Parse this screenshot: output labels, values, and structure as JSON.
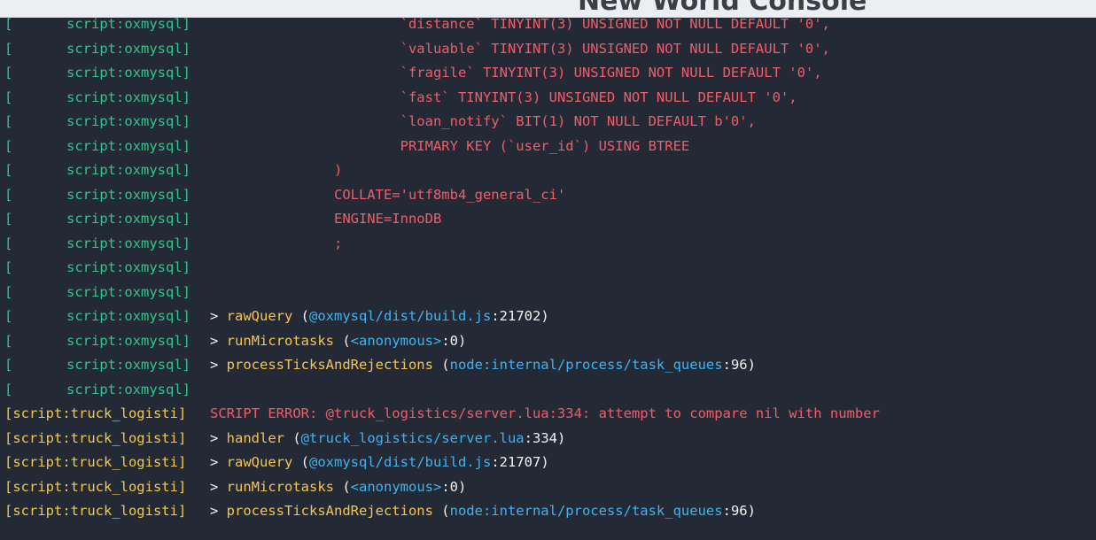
{
  "window": {
    "title": "New World Console"
  },
  "console": {
    "lines": [
      {
        "kind": "sql",
        "channel": "script:oxmysql",
        "text": "`distance` TINYINT(3) UNSIGNED NOT NULL DEFAULT '0',",
        "indent": "                       "
      },
      {
        "kind": "sql",
        "channel": "script:oxmysql",
        "text": "`valuable` TINYINT(3) UNSIGNED NOT NULL DEFAULT '0',",
        "indent": "                       "
      },
      {
        "kind": "sql",
        "channel": "script:oxmysql",
        "text": "`fragile` TINYINT(3) UNSIGNED NOT NULL DEFAULT '0',",
        "indent": "                       "
      },
      {
        "kind": "sql",
        "channel": "script:oxmysql",
        "text": "`fast` TINYINT(3) UNSIGNED NOT NULL DEFAULT '0',",
        "indent": "                       "
      },
      {
        "kind": "sql",
        "channel": "script:oxmysql",
        "text": "`loan_notify` BIT(1) NOT NULL DEFAULT b'0',",
        "indent": "                       "
      },
      {
        "kind": "sql",
        "channel": "script:oxmysql",
        "text": "PRIMARY KEY (`user_id`) USING BTREE",
        "indent": "                       "
      },
      {
        "kind": "sql",
        "channel": "script:oxmysql",
        "text": ")",
        "indent": "               "
      },
      {
        "kind": "sql",
        "channel": "script:oxmysql",
        "text": "COLLATE='utf8mb4_general_ci'",
        "indent": "               "
      },
      {
        "kind": "sql",
        "channel": "script:oxmysql",
        "text": "ENGINE=InnoDB",
        "indent": "               "
      },
      {
        "kind": "sql",
        "channel": "script:oxmysql",
        "text": ";",
        "indent": "               "
      },
      {
        "kind": "empty",
        "channel": "script:oxmysql"
      },
      {
        "kind": "empty",
        "channel": "script:oxmysql"
      },
      {
        "kind": "trace",
        "channel": "script:oxmysql",
        "fn": "rawQuery",
        "loc": "@oxmysql/dist/build.js",
        "line": "21702"
      },
      {
        "kind": "trace",
        "channel": "script:oxmysql",
        "fn": "runMicrotasks",
        "loc": "<anonymous>",
        "line": "0"
      },
      {
        "kind": "trace",
        "channel": "script:oxmysql",
        "fn": "processTicksAndRejections",
        "loc": "node:internal/process/task_queues",
        "line": "96"
      },
      {
        "kind": "empty",
        "channel": "script:oxmysql"
      },
      {
        "kind": "error",
        "channel": "[script:truck_logisti]",
        "text": "SCRIPT ERROR: @truck_logistics/server.lua:334: attempt to compare nil with number"
      },
      {
        "kind": "tracef",
        "channel": "[script:truck_logisti]",
        "fn": "handler",
        "loc": "@truck_logistics/server.lua",
        "line": "334"
      },
      {
        "kind": "tracef",
        "channel": "[script:truck_logisti]",
        "fn": "rawQuery",
        "loc": "@oxmysql/dist/build.js",
        "line": "21707"
      },
      {
        "kind": "tracef",
        "channel": "[script:truck_logisti]",
        "fn": "runMicrotasks",
        "loc": "<anonymous>",
        "line": "0"
      },
      {
        "kind": "tracef",
        "channel": "[script:truck_logisti]",
        "fn": "processTicksAndRejections",
        "loc": "node:internal/process/task_queues",
        "line": "96"
      }
    ]
  },
  "colors": {
    "background": "#242a35",
    "channel": "#31c48d",
    "channel_full": "#f2c94c",
    "sql": "#ef5d6b",
    "function": "#f6c453",
    "link": "#3eb3f2"
  }
}
